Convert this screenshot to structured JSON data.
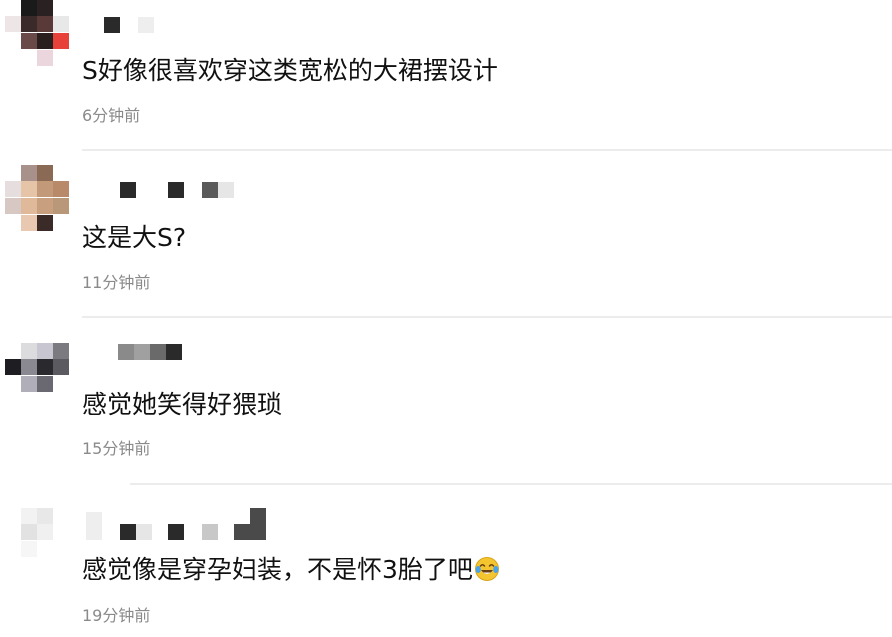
{
  "comments": [
    {
      "text": "S好像很喜欢穿这类宽松的大裙摆设计",
      "time": "6分钟前",
      "username": "",
      "avatar_colors": [
        "#1a1a1a",
        "#e8e8e8",
        "#5a3a38",
        "#2a1f1f",
        "#e8413a",
        "#ead6dc"
      ]
    },
    {
      "text": "这是大S?",
      "time": "11分钟前",
      "username": "",
      "avatar_colors": [
        "#a8918a",
        "#8a6a55",
        "#e6c4a8",
        "#c29a7a",
        "#b88a6a",
        "#e0b89a",
        "#3a2a28"
      ]
    },
    {
      "text": "感觉她笑得好猥琐",
      "time": "15分钟前",
      "username": "",
      "avatar_colors": [
        "#dcdcde",
        "#7a7a80",
        "#2a2a2e",
        "#c8c6d0",
        "#8a8890",
        "#b0aeb8"
      ]
    },
    {
      "text": "感觉像是穿孕妇装，不是怀3胎了吧",
      "time": "19分钟前",
      "username": "",
      "avatar_colors": [
        "#f0f0f0",
        "#e0e0e0",
        "#f6f6f6"
      ]
    }
  ],
  "emoji": {
    "name": "laughing-crying-emoji",
    "face_color": "#f5c530",
    "tear_color": "#4aa3e8"
  }
}
